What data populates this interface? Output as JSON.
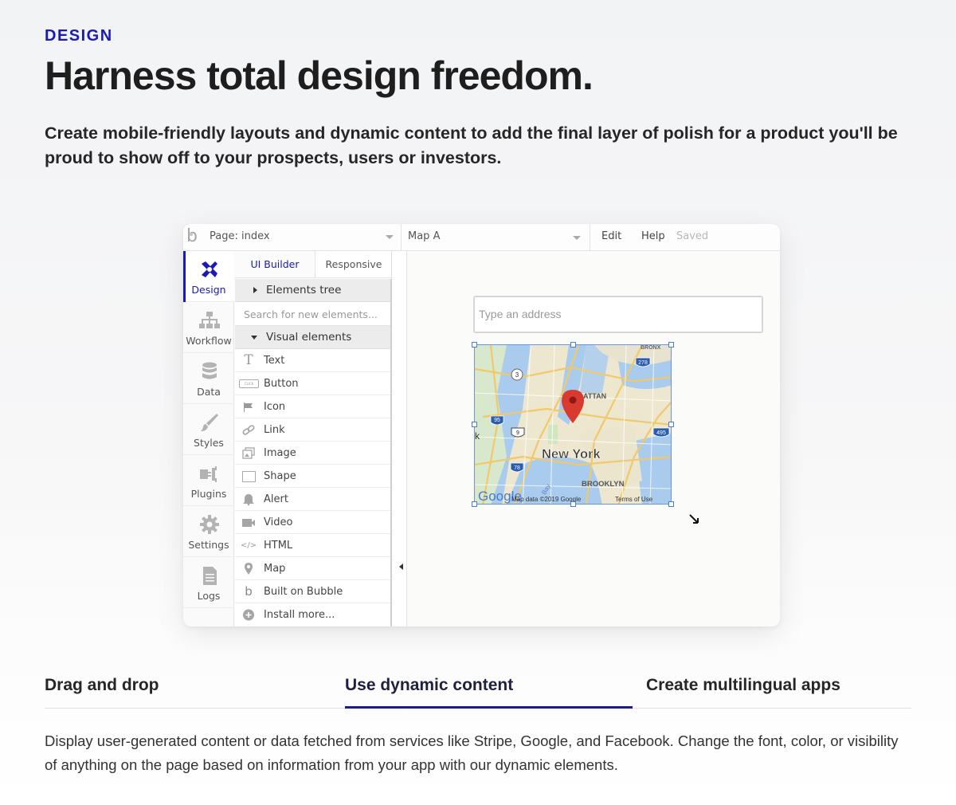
{
  "section": {
    "eyebrow": "DESIGN",
    "headline": "Harness total design freedom.",
    "subhead": "Create mobile-friendly layouts and dynamic content to add the final layer of polish for a product you'll be proud to show off to your prospects, users or investors."
  },
  "editor": {
    "topbar": {
      "page_selector": "Page: index",
      "element_selector": "Map A",
      "edit_menu": "Edit",
      "help_menu": "Help",
      "save_status": "Saved"
    },
    "nav": [
      {
        "label": "Design",
        "icon": "design-cross-icon",
        "active": true
      },
      {
        "label": "Workflow",
        "icon": "workflow-tree-icon"
      },
      {
        "label": "Data",
        "icon": "database-icon"
      },
      {
        "label": "Styles",
        "icon": "paintbrush-icon"
      },
      {
        "label": "Plugins",
        "icon": "plug-icon"
      },
      {
        "label": "Settings",
        "icon": "gear-icon"
      },
      {
        "label": "Logs",
        "icon": "document-icon"
      }
    ],
    "panel": {
      "tabs": [
        "UI Builder",
        "Responsive"
      ],
      "elements_tree": "Elements tree",
      "search_placeholder": "Search for new elements...",
      "visual_elements": "Visual elements",
      "items": [
        {
          "label": "Text",
          "icon": "text-t-icon"
        },
        {
          "label": "Button",
          "icon": "button-icon",
          "icon_text": "CLICK"
        },
        {
          "label": "Icon",
          "icon": "flag-icon"
        },
        {
          "label": "Link",
          "icon": "link-icon"
        },
        {
          "label": "Image",
          "icon": "image-icon"
        },
        {
          "label": "Shape",
          "icon": "square-icon"
        },
        {
          "label": "Alert",
          "icon": "bell-icon"
        },
        {
          "label": "Video",
          "icon": "video-icon"
        },
        {
          "label": "HTML",
          "icon": "code-icon",
          "icon_text": "</>"
        },
        {
          "label": "Map",
          "icon": "pin-icon"
        },
        {
          "label": "Built on Bubble",
          "icon": "bubble-logo-icon"
        },
        {
          "label": "Install more...",
          "icon": "plus-circle-icon"
        }
      ]
    },
    "canvas": {
      "address_placeholder": "Type an address",
      "map": {
        "city_label": "New York",
        "borough_label": "BROOKLYN",
        "manhattan_partial": "ATTAN",
        "bronx_partial": "BRONX",
        "credits": "Map data ©2019 Google",
        "terms": "Terms of Use",
        "brand": "Google",
        "bay_label": "Bay",
        "edge_letter": "k",
        "shields": [
          "3",
          "278",
          "95",
          "9",
          "495",
          "78"
        ]
      }
    }
  },
  "tabs": [
    {
      "label": "Drag and drop"
    },
    {
      "label": "Use dynamic content",
      "active": true
    },
    {
      "label": "Create multilingual apps"
    }
  ],
  "description": "Display user-generated content or data fetched from services like Stripe, Google, and Facebook. Change the font, color, or visibility of anything on the page based on information from your app with our dynamic elements.",
  "colors": {
    "accent": "#1a1ab8",
    "active_tab_underline": "#1b1b8f",
    "map_pin": "#d93a30"
  }
}
